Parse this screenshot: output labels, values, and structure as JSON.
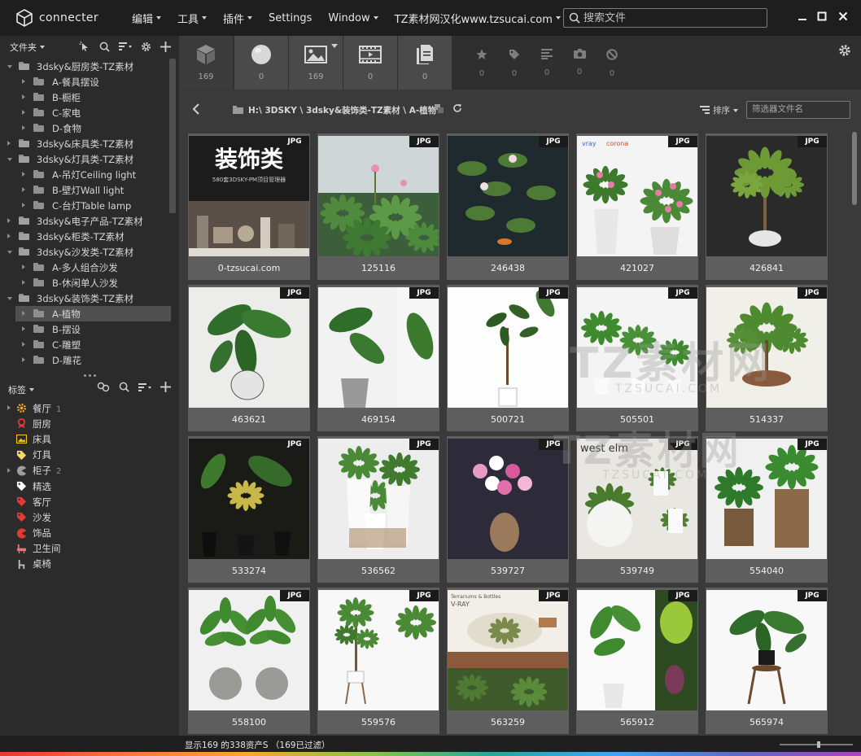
{
  "app": {
    "name": "connecter"
  },
  "menu": [
    {
      "label": "编辑",
      "dropdown": true
    },
    {
      "label": "工具",
      "dropdown": true
    },
    {
      "label": "插件",
      "dropdown": true
    },
    {
      "label": "Settings",
      "dropdown": false
    },
    {
      "label": "Window",
      "dropdown": true
    },
    {
      "label": "TZ素材网汉化www.tzsucai.com",
      "dropdown": true
    }
  ],
  "search": {
    "placeholder": "搜索文件"
  },
  "folders_panel": {
    "title": "文件夹"
  },
  "folder_tree": [
    {
      "label": "3dsky&厨房类-TZ素材",
      "level": 0,
      "expanded": true
    },
    {
      "label": "A-餐具摆设",
      "level": 1
    },
    {
      "label": "B-橱柜",
      "level": 1
    },
    {
      "label": "C-家电",
      "level": 1
    },
    {
      "label": "D-食物",
      "level": 1
    },
    {
      "label": "3dsky&床具类-TZ素材",
      "level": 0,
      "expanded": false
    },
    {
      "label": "3dsky&灯具类-TZ素材",
      "level": 0,
      "expanded": true
    },
    {
      "label": "A-吊灯Ceiling light",
      "level": 1
    },
    {
      "label": "B-壁灯Wall light",
      "level": 1
    },
    {
      "label": "C-台灯Table lamp",
      "level": 1
    },
    {
      "label": "3dsky&电子产品-TZ素材",
      "level": 0,
      "expanded": false
    },
    {
      "label": "3dsky&柜类-TZ素材",
      "level": 0,
      "expanded": false
    },
    {
      "label": "3dsky&沙发类-TZ素材",
      "level": 0,
      "expanded": true
    },
    {
      "label": "A-多人组合沙发",
      "level": 1
    },
    {
      "label": "B-休闲单人沙发",
      "level": 1
    },
    {
      "label": "3dsky&装饰类-TZ素材",
      "level": 0,
      "expanded": true
    },
    {
      "label": "A-植物",
      "level": 1,
      "selected": true
    },
    {
      "label": "B-摆设",
      "level": 1
    },
    {
      "label": "C-雕塑",
      "level": 1
    },
    {
      "label": "D-雕花",
      "level": 1
    }
  ],
  "tags_panel": {
    "title": "标签"
  },
  "tags": [
    {
      "label": "餐厅",
      "count": "1",
      "icon": "gear-icon",
      "color": "#f5a623",
      "expandable": true
    },
    {
      "label": "厨房",
      "count": "",
      "icon": "award-icon",
      "color": "#e53935",
      "expandable": false
    },
    {
      "label": "床具",
      "count": "",
      "icon": "image-icon",
      "color": "#f5c518",
      "expandable": false
    },
    {
      "label": "灯具",
      "count": "",
      "icon": "tag-icon",
      "color": "#f5d76e",
      "expandable": false
    },
    {
      "label": "柜子",
      "count": "2",
      "icon": "pacman-icon",
      "color": "#9e9e9e",
      "expandable": true
    },
    {
      "label": "精选",
      "count": "",
      "icon": "tag-icon",
      "color": "#ffffff",
      "expandable": false
    },
    {
      "label": "客厅",
      "count": "",
      "icon": "tag-icon",
      "color": "#e53935",
      "expandable": false
    },
    {
      "label": "沙发",
      "count": "",
      "icon": "tag-icon",
      "color": "#e53935",
      "expandable": false
    },
    {
      "label": "饰品",
      "count": "",
      "icon": "pacman-icon",
      "color": "#e53935",
      "expandable": false
    },
    {
      "label": "卫生间",
      "count": "",
      "icon": "bath-icon",
      "color": "#e57373",
      "expandable": false
    },
    {
      "label": "桌椅",
      "count": "",
      "icon": "chair-icon",
      "color": "#bdbdbd",
      "expandable": false
    }
  ],
  "type_filters": [
    {
      "name": "3d-model",
      "icon": "cube-icon",
      "count": "169",
      "active": false
    },
    {
      "name": "material",
      "icon": "sphere-icon",
      "count": "0",
      "active": true
    },
    {
      "name": "image",
      "icon": "image-icon",
      "count": "169",
      "active": true
    },
    {
      "name": "video",
      "icon": "film-icon",
      "count": "0",
      "active": true
    },
    {
      "name": "document",
      "icon": "document-icon",
      "count": "0",
      "active": true
    }
  ],
  "sub_filters": [
    {
      "icon": "star-icon",
      "count": "0"
    },
    {
      "icon": "tag-icon",
      "count": "0"
    },
    {
      "icon": "lines-icon",
      "count": "0"
    },
    {
      "icon": "camera-icon",
      "count": "0"
    },
    {
      "icon": "ban-icon",
      "count": "0"
    }
  ],
  "path": {
    "text": "H:\\ 3DSKY \\ 3dsky&装饰类-TZ素材 \\ A-植物"
  },
  "sort": {
    "label": "排序"
  },
  "filter": {
    "placeholder": "筛选器文件名"
  },
  "assets": [
    {
      "name": "0-tzsucai.com",
      "type": "JPG",
      "theme": "banner"
    },
    {
      "name": "125116",
      "type": "JPG",
      "theme": "lotus"
    },
    {
      "name": "246438",
      "type": "JPG",
      "theme": "waterlily"
    },
    {
      "name": "421027",
      "type": "JPG",
      "theme": "flowers-white"
    },
    {
      "name": "426841",
      "type": "JPG",
      "theme": "tree-dark"
    },
    {
      "name": "463621",
      "type": "JPG",
      "theme": "monstera"
    },
    {
      "name": "469154",
      "type": "JPG",
      "theme": "monstera-split"
    },
    {
      "name": "500721",
      "type": "JPG",
      "theme": "ficus"
    },
    {
      "name": "505501",
      "type": "JPG",
      "theme": "three-pots"
    },
    {
      "name": "514337",
      "type": "JPG",
      "theme": "bonsai"
    },
    {
      "name": "533274",
      "type": "JPG",
      "theme": "dark-plants"
    },
    {
      "name": "536562",
      "type": "JPG",
      "theme": "white-vases"
    },
    {
      "name": "539727",
      "type": "JPG",
      "theme": "vase-flowers"
    },
    {
      "name": "539749",
      "type": "JPG",
      "theme": "westelm"
    },
    {
      "name": "554040",
      "type": "JPG",
      "theme": "wood-boxes"
    },
    {
      "name": "558100",
      "type": "JPG",
      "theme": "palms"
    },
    {
      "name": "559576",
      "type": "JPG",
      "theme": "tree-stand"
    },
    {
      "name": "563259",
      "type": "JPG",
      "theme": "bottle"
    },
    {
      "name": "565912",
      "type": "JPG",
      "theme": "banana"
    },
    {
      "name": "565974",
      "type": "JPG",
      "theme": "monstera-stand"
    }
  ],
  "status": {
    "text": "显示169 的338资产S （169已过滤）"
  },
  "colors": {
    "accent": "#505050",
    "titlebar": "#1e1e1e",
    "badge": "#1a1a1a"
  }
}
